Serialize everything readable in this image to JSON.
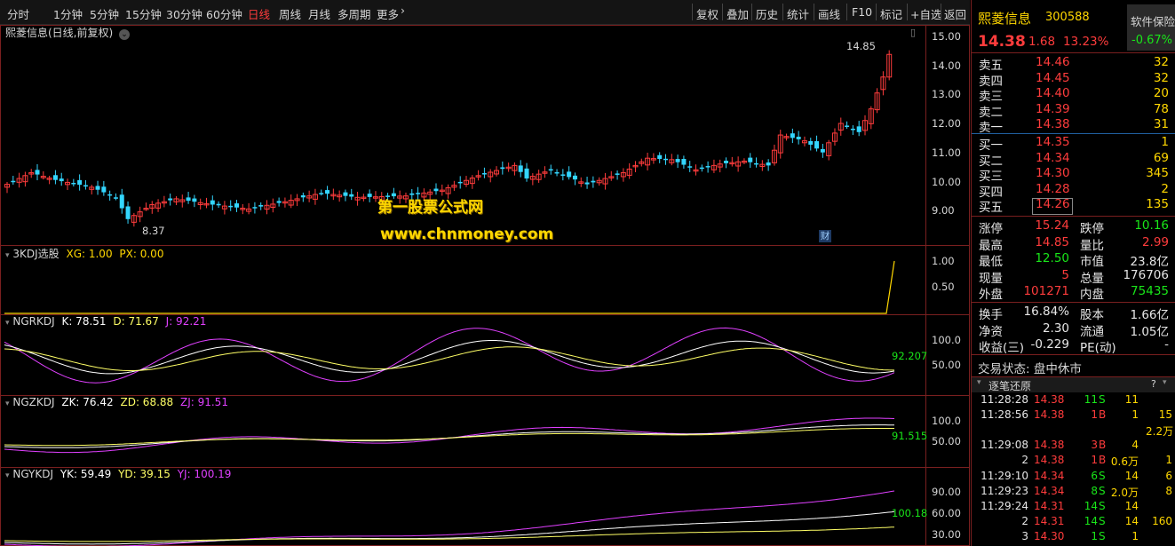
{
  "toolbar": {
    "periods": [
      "分时",
      "1分钟",
      "5分钟",
      "15分钟",
      "30分钟",
      "60分钟",
      "日线",
      "周线",
      "月线",
      "多周期",
      "更多"
    ],
    "active": "日线",
    "tools": [
      "复权",
      "叠加",
      "历史",
      "统计",
      "画线",
      "F10",
      "标记",
      "+自选",
      "返回"
    ]
  },
  "main_panel": {
    "title": "熙菱信息(日线,前复权)",
    "high_label": "14.85",
    "low_label": "8.37",
    "fin_badge": "财",
    "y_ticks": [
      "15.00",
      "14.00",
      "13.00",
      "12.00",
      "11.00",
      "10.00",
      "9.00"
    ],
    "colors": {
      "up": "#ff3c3c",
      "down": "#33d6ff"
    }
  },
  "watermark": {
    "line1": "第一股票公式网",
    "line2": "www.chnmoney.com"
  },
  "panel_3kdj": {
    "name": "3KDJ选股",
    "xg_label": "XG: 1.00",
    "px_label": "PX: 0.00",
    "y_ticks": [
      "1.00",
      "0.50"
    ]
  },
  "panel_ngrkdj": {
    "name": "NGRKDJ",
    "k_label": "K: 78.51",
    "d_label": "D: 71.67",
    "j_label": "J: 92.21",
    "tag": "92.207",
    "y_ticks": [
      "100.0",
      "50.00"
    ]
  },
  "panel_ngzkdj": {
    "name": "NGZKDJ",
    "k_label": "ZK: 76.42",
    "d_label": "ZD: 68.88",
    "j_label": "ZJ: 91.51",
    "tag": "91.515",
    "y_ticks": [
      "100.0",
      "50.00"
    ]
  },
  "panel_ngykdj": {
    "name": "NGYKDJ",
    "k_label": "YK: 59.49",
    "d_label": "YD: 39.15",
    "j_label": "YJ: 100.19",
    "tag": "100.18",
    "y_ticks": [
      "90.00",
      "60.00",
      "30.00"
    ]
  },
  "quote": {
    "name": "熙菱信息",
    "code": "300588",
    "software_label": "软件保险",
    "price": "14.38",
    "change": "1.68",
    "change_pct": "13.23%",
    "side_pct": "-0.67%",
    "sells": [
      {
        "label": "卖五",
        "price": "14.46",
        "vol": "32"
      },
      {
        "label": "卖四",
        "price": "14.45",
        "vol": "32"
      },
      {
        "label": "卖三",
        "price": "14.40",
        "vol": "20"
      },
      {
        "label": "卖二",
        "price": "14.39",
        "vol": "78"
      },
      {
        "label": "卖一",
        "price": "14.38",
        "vol": "31"
      }
    ],
    "buys": [
      {
        "label": "买一",
        "price": "14.35",
        "vol": "1"
      },
      {
        "label": "买二",
        "price": "14.34",
        "vol": "69"
      },
      {
        "label": "买三",
        "price": "14.30",
        "vol": "345"
      },
      {
        "label": "买四",
        "price": "14.28",
        "vol": "2"
      },
      {
        "label": "买五",
        "price": "14.26",
        "vol": "135"
      }
    ],
    "stats": [
      {
        "l1": "涨停",
        "v1": "15.24",
        "c1": "red",
        "l2": "跌停",
        "v2": "10.16",
        "c2": "green"
      },
      {
        "l1": "最高",
        "v1": "14.85",
        "c1": "red",
        "l2": "量比",
        "v2": "2.99",
        "c2": "red"
      },
      {
        "l1": "最低",
        "v1": "12.50",
        "c1": "green",
        "l2": "市值",
        "v2": "23.8亿",
        "c2": "white"
      },
      {
        "l1": "现量",
        "v1": "5",
        "c1": "red",
        "l2": "总量",
        "v2": "176706",
        "c2": "white"
      },
      {
        "l1": "外盘",
        "v1": "101271",
        "c1": "red",
        "l2": "内盘",
        "v2": "75435",
        "c2": "green"
      }
    ],
    "fund": [
      {
        "l1": "换手",
        "v1": "16.84%",
        "l2": "股本",
        "v2": "1.66亿"
      },
      {
        "l1": "净资",
        "v1": "2.30",
        "l2": "流通",
        "v2": "1.05亿"
      },
      {
        "l1": "收益(三)",
        "v1": "-0.229",
        "l2": "PE(动)",
        "v2": "-"
      }
    ],
    "trade_status": "交易状态: 盘中休市",
    "tick_header": "逐笔还原",
    "tick_header_icon": "?",
    "ticks": [
      {
        "time": "11:28:28",
        "price": "14.38",
        "pc": "red",
        "vol": "11",
        "side": "S",
        "n": "11",
        "extra": ""
      },
      {
        "time": "11:28:56",
        "price": "14.38",
        "pc": "red",
        "vol": "1",
        "side": "B",
        "n": "1",
        "extra": "15"
      },
      {
        "time": "",
        "price": "",
        "pc": "red",
        "vol": "",
        "side": "",
        "n": "",
        "extra": "2.2万"
      },
      {
        "time": "11:29:08",
        "price": "14.38",
        "pc": "red",
        "vol": "3",
        "side": "B",
        "n": "4",
        "extra": ""
      },
      {
        "time": "2",
        "price": "14.38",
        "pc": "red",
        "vol": "1",
        "side": "B",
        "n": "0.6万",
        "extra": "1"
      },
      {
        "time": "11:29:10",
        "price": "14.34",
        "pc": "red",
        "vol": "6",
        "side": "S",
        "n": "14",
        "extra": "6"
      },
      {
        "time": "11:29:23",
        "price": "14.34",
        "pc": "red",
        "vol": "8",
        "side": "S",
        "n": "2.0万",
        "extra": "8"
      },
      {
        "time": "11:29:24",
        "price": "14.31",
        "pc": "red",
        "vol": "14",
        "side": "S",
        "n": "14",
        "extra": ""
      },
      {
        "time": "2",
        "price": "14.31",
        "pc": "red",
        "vol": "14",
        "side": "S",
        "n": "14",
        "extra": "160"
      },
      {
        "time": "3",
        "price": "14.30",
        "pc": "red",
        "vol": "1",
        "side": "S",
        "n": "1",
        "extra": ""
      }
    ]
  }
}
